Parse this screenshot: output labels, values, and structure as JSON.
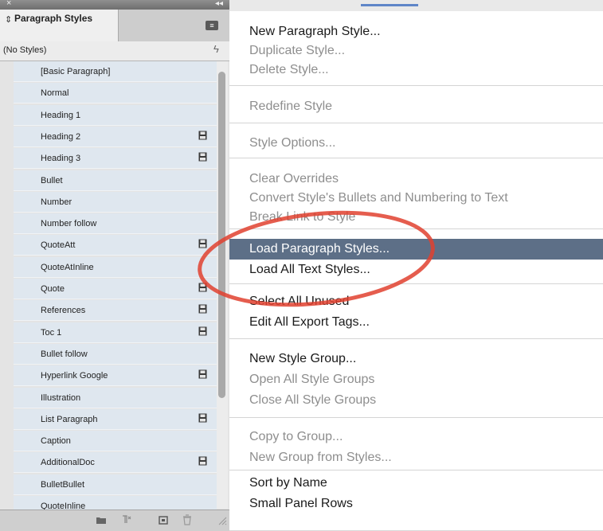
{
  "panel": {
    "close_glyph": "×",
    "collapse_glyph": "◂◂",
    "tab_arrow": "⇕",
    "tab_title": "Paragraph Styles",
    "menu_glyph": "≡",
    "no_styles_label": "(No Styles)",
    "styles": [
      {
        "label": "[Basic Paragraph]",
        "saved": false
      },
      {
        "label": "Normal",
        "saved": false
      },
      {
        "label": "Heading 1",
        "saved": false
      },
      {
        "label": "Heading 2",
        "saved": true
      },
      {
        "label": "Heading 3",
        "saved": true
      },
      {
        "label": "Bullet",
        "saved": false
      },
      {
        "label": "Number",
        "saved": false
      },
      {
        "label": "Number follow",
        "saved": false
      },
      {
        "label": "QuoteAtt",
        "saved": true
      },
      {
        "label": "QuoteAtInline",
        "saved": false
      },
      {
        "label": "Quote",
        "saved": true
      },
      {
        "label": "References",
        "saved": true
      },
      {
        "label": "Toc 1",
        "saved": true
      },
      {
        "label": "Bullet follow",
        "saved": false
      },
      {
        "label": "Hyperlink Google",
        "saved": true
      },
      {
        "label": "Illustration",
        "saved": false
      },
      {
        "label": "List Paragraph",
        "saved": true
      },
      {
        "label": "Caption",
        "saved": false
      },
      {
        "label": "AdditionalDoc",
        "saved": true
      },
      {
        "label": "BulletBullet",
        "saved": false
      },
      {
        "label": "QuoteInline",
        "saved": false
      }
    ]
  },
  "menu": {
    "items": [
      {
        "label": "New Paragraph Style...",
        "state": "on"
      },
      {
        "label": "Duplicate Style...",
        "state": "off"
      },
      {
        "label": "Delete Style...",
        "state": "off"
      },
      {
        "label": "Redefine Style",
        "state": "off"
      },
      {
        "label": "Style Options...",
        "state": "off"
      },
      {
        "label": "Clear Overrides",
        "state": "off"
      },
      {
        "label": "Convert Style's Bullets and Numbering to Text",
        "state": "off"
      },
      {
        "label": "Break Link to Style",
        "state": "off"
      },
      {
        "label": "Load Paragraph Styles...",
        "state": "hl"
      },
      {
        "label": "Load All Text Styles...",
        "state": "on"
      },
      {
        "label": "Select All Unused",
        "state": "on"
      },
      {
        "label": "Edit All Export Tags...",
        "state": "on"
      },
      {
        "label": "New Style Group...",
        "state": "on"
      },
      {
        "label": "Open All Style Groups",
        "state": "off"
      },
      {
        "label": "Close All Style Groups",
        "state": "off"
      },
      {
        "label": "Copy to Group...",
        "state": "off"
      },
      {
        "label": "New Group from Styles...",
        "state": "off"
      },
      {
        "label": "Sort by Name",
        "state": "on"
      },
      {
        "label": "Small Panel Rows",
        "state": "on"
      }
    ]
  },
  "colors": {
    "highlight": "#5d6f87",
    "annotation_circle": "#e0412f",
    "row_bg": "#dfe7ef"
  }
}
